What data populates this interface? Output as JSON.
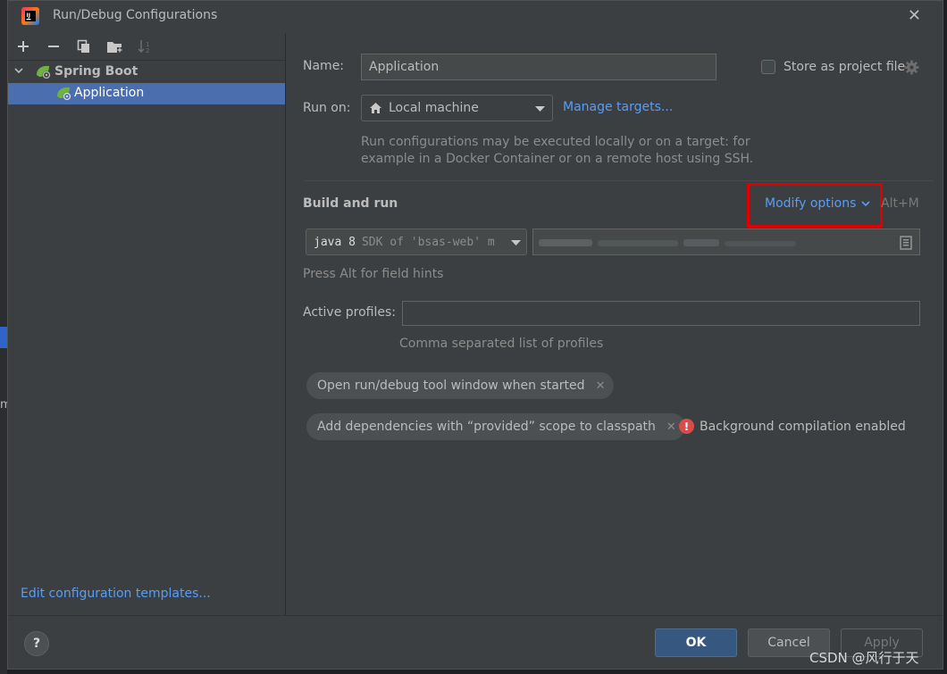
{
  "window": {
    "title": "Run/Debug Configurations"
  },
  "toolbar": {
    "icons": [
      "add-icon",
      "remove-icon",
      "copy-icon",
      "folder-icon",
      "sort-icon"
    ]
  },
  "tree": {
    "group_label": "Spring Boot",
    "child_label": "Application"
  },
  "left_footer": {
    "edit_templates_label": "Edit configuration templates..."
  },
  "form": {
    "name_label": "Name:",
    "name_value": "Application",
    "store_label": "Store as project file",
    "run_on_label": "Run on:",
    "run_on_value": "Local machine",
    "manage_targets_label": "Manage targets...",
    "run_on_hint_line1": "Run configurations may be executed locally or on a target: for",
    "run_on_hint_line2": "example in a Docker Container or on a remote host using SSH.",
    "build_and_run_label": "Build and run",
    "modify_options_label": "Modify options",
    "modify_options_shortcut": "Alt+M",
    "sdk_prefix": "java 8",
    "sdk_value": "SDK of 'bsas-web' m",
    "press_alt_hint": "Press Alt for field hints",
    "active_profiles_label": "Active profiles:",
    "active_profiles_value": "",
    "active_profiles_hint": "Comma separated list of profiles",
    "chip1_label": "Open run/debug tool window when started",
    "chip2_label": "Add dependencies with “provided” scope to classpath",
    "bg_compilation_label": "Background compilation enabled"
  },
  "buttons": {
    "help_label": "?",
    "ok_label": "OK",
    "cancel_label": "Cancel",
    "apply_label": "Apply"
  },
  "watermark": {
    "text": "CSDN @风行于天"
  },
  "colors": {
    "accent": "#589df6",
    "selection": "#4b6eaf",
    "highlight": "#e00000",
    "error": "#d94c4c"
  }
}
